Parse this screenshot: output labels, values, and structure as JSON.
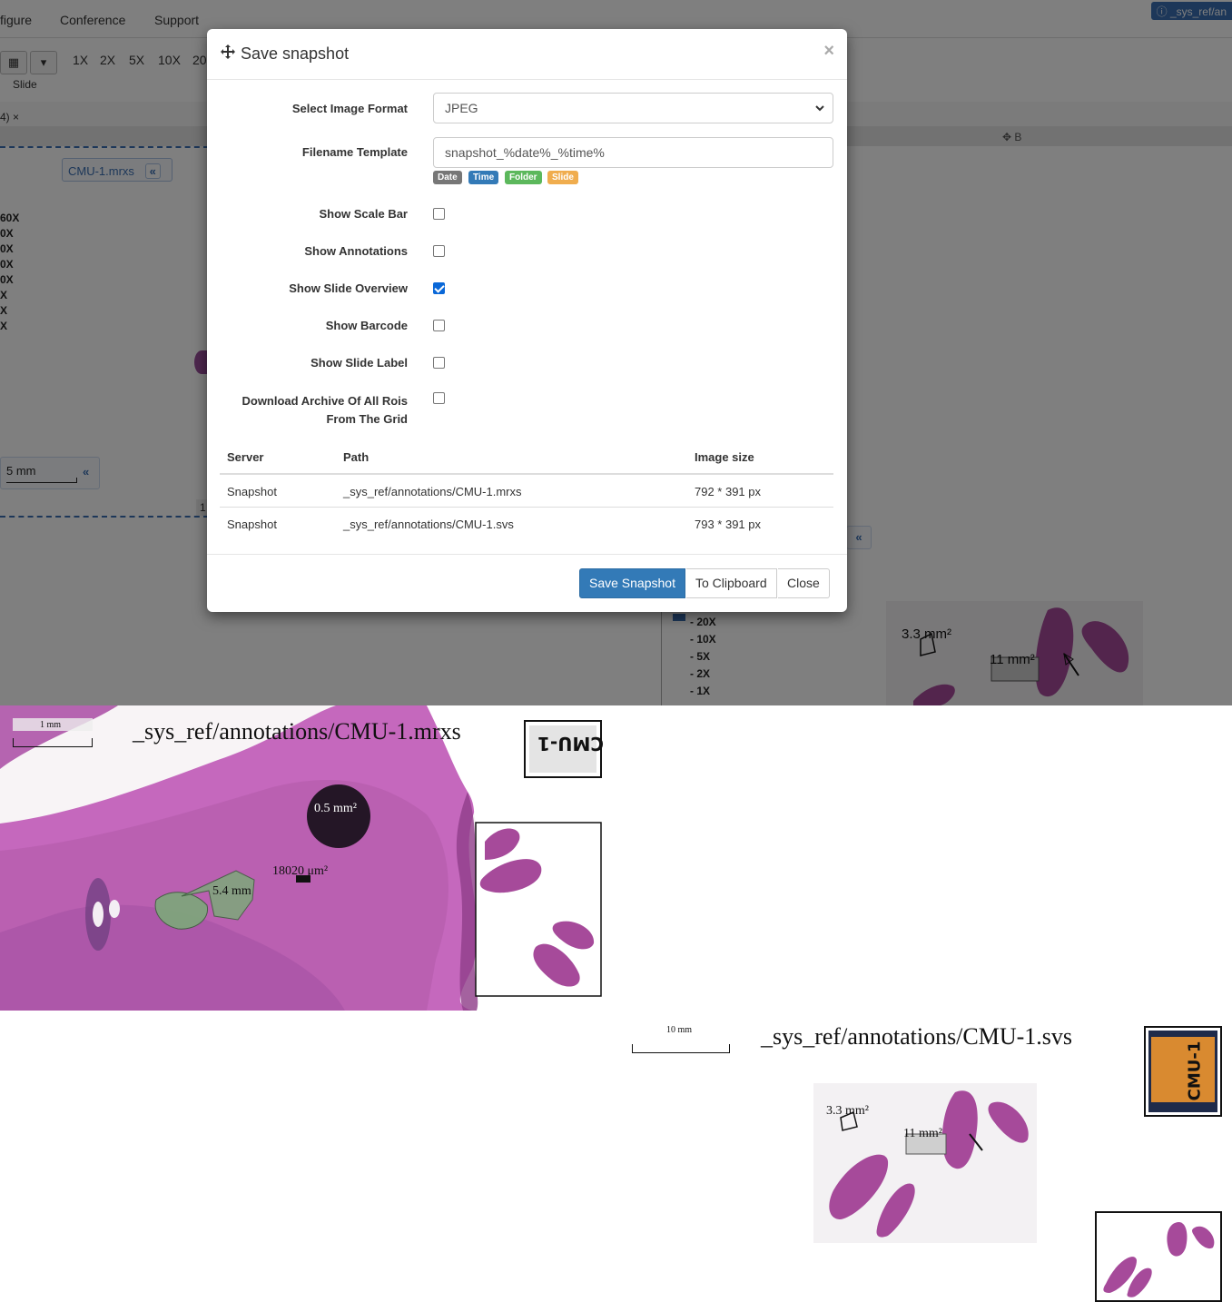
{
  "menubar": {
    "items": [
      "figure",
      "Conference",
      "Support"
    ],
    "info_text": "_sys_ref/an"
  },
  "toolbar": {
    "zoom_links": [
      "1X",
      "2X",
      "5X",
      "10X",
      "20"
    ],
    "slide_label": "Slide"
  },
  "tab": {
    "label": "4) ×"
  },
  "panel_b_header": "B",
  "left_viewer": {
    "slide_name": "CMU-1.mrxs",
    "collapse": "«",
    "magnifications": [
      "60X",
      "0X",
      "0X",
      "0X",
      "0X",
      "X",
      "X",
      "X"
    ],
    "scale_label": "5 mm",
    "scale_chev": "«",
    "page_indicator": "1"
  },
  "right_viewer": {
    "collapse": "«",
    "magnifications": [
      "- 20X",
      "- 10X",
      "- 5X",
      "- 2X",
      "- 1X"
    ],
    "annot_area": "3.3 mm²",
    "annot_len": "11 mm²"
  },
  "modal": {
    "title": "Save snapshot",
    "close": "×",
    "format": {
      "label": "Select Image Format",
      "value": "JPEG"
    },
    "filename": {
      "label": "Filename Template",
      "value": "snapshot_%date%_%time%",
      "tags": [
        {
          "label": "Date",
          "color": "#777777"
        },
        {
          "label": "Time",
          "color": "#337ab7"
        },
        {
          "label": "Folder",
          "color": "#5cb85c"
        },
        {
          "label": "Slide",
          "color": "#f0ad4e"
        }
      ]
    },
    "options": [
      {
        "label": "Show Scale Bar",
        "checked": false
      },
      {
        "label": "Show Annotations",
        "checked": false
      },
      {
        "label": "Show Slide Overview",
        "checked": true
      },
      {
        "label": "Show Barcode",
        "checked": false
      },
      {
        "label": "Show Slide Label",
        "checked": false
      }
    ],
    "archive": {
      "line1": "Download Archive Of All Rois",
      "line2": "From The Grid",
      "checked": false
    },
    "table": {
      "headers": [
        "Server",
        "Path",
        "Image size"
      ],
      "rows": [
        [
          "Snapshot",
          "_sys_ref/annotations/CMU-1.mrxs",
          "792 * 391 px"
        ],
        [
          "Snapshot",
          "_sys_ref/annotations/CMU-1.svs",
          "793 * 391 px"
        ]
      ]
    },
    "buttons": {
      "save": "Save Snapshot",
      "clipboard": "To Clipboard",
      "close": "Close"
    }
  },
  "snapshot1": {
    "title": "_sys_ref/annotations/CMU-1.mrxs",
    "scale": "1 mm",
    "label_text": "CMU-1",
    "annot_circle": "0.5 mm²",
    "annot_area": "18020 μm²",
    "annot_len": "5.4 mm"
  },
  "snapshot2": {
    "title": "_sys_ref/annotations/CMU-1.svs",
    "scale": "10 mm",
    "label_text": "CMU-1",
    "annot_area": "3.3 mm²",
    "annot_len": "11 mm²"
  }
}
